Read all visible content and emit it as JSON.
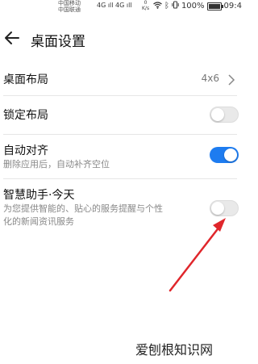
{
  "status_bar": {
    "carrier_1": "中国移动",
    "carrier_2": "中国联通",
    "network": "4G ıll 4G ıll",
    "speed_value": "0",
    "speed_unit": "K/s",
    "battery": "100%",
    "time": "09:4"
  },
  "header": {
    "title": "桌面设置"
  },
  "settings": {
    "layout": {
      "label": "桌面布局",
      "value": "4x6"
    },
    "lock": {
      "label": "锁定布局",
      "enabled": false
    },
    "auto_align": {
      "label": "自动对齐",
      "description": "删除应用后，自动补齐空位",
      "enabled": true
    },
    "assistant": {
      "label": "智慧助手·今天",
      "description_line1": "为您提供智能的、贴心的服务提醒与个性",
      "description_line2": "化的新闻资讯服务",
      "enabled": false
    }
  },
  "watermark": "爱刨根知识网",
  "colors": {
    "accent": "#1e7cf0",
    "annotation_arrow": "#e0262b"
  }
}
